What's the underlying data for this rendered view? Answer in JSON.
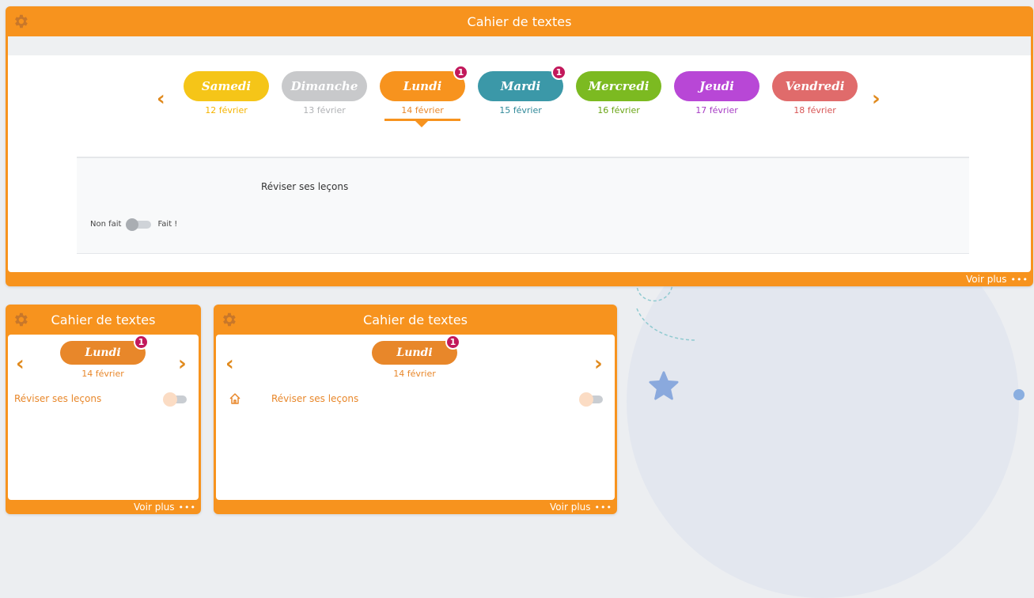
{
  "colors": {
    "accent": "#f7931e",
    "samedi": "#f5c518",
    "dimanche": "#c8c9cb",
    "lundi": "#f7931e",
    "mardi": "#3b98a8",
    "mercredi": "#7cba21",
    "jeudi": "#b847d6",
    "vendredi": "#e06b6b",
    "badge": "#c2185b"
  },
  "main_widget": {
    "title": "Cahier de textes",
    "days": [
      {
        "label": "Samedi",
        "date": "12 février",
        "color": "#f5c518",
        "date_color": "#f5b400",
        "badge": ""
      },
      {
        "label": "Dimanche",
        "date": "13 février",
        "color": "#c8c9cb",
        "date_color": "#b0b2b5",
        "badge": ""
      },
      {
        "label": "Lundi",
        "date": "14 février",
        "color": "#f7931e",
        "date_color": "#e8872a",
        "badge": "1"
      },
      {
        "label": "Mardi",
        "date": "15 février",
        "color": "#3b98a8",
        "date_color": "#2f8999",
        "badge": "1"
      },
      {
        "label": "Mercredi",
        "date": "16 février",
        "color": "#7cba21",
        "date_color": "#6aa515",
        "badge": ""
      },
      {
        "label": "Jeudi",
        "date": "17 février",
        "color": "#b847d6",
        "date_color": "#a63bc4",
        "badge": ""
      },
      {
        "label": "Vendredi",
        "date": "18 février",
        "color": "#e06b6b",
        "date_color": "#d85555",
        "badge": ""
      }
    ],
    "task": "Réviser ses leçons",
    "toggle_off_label": "Non fait",
    "toggle_on_label": "Fait !",
    "footer": "Voir plus",
    "footer_dots": "•••"
  },
  "widget_small": {
    "title": "Cahier de textes",
    "day_label": "Lundi",
    "day_date": "14 février",
    "badge": "1",
    "task": "Réviser ses leçons",
    "footer": "Voir plus",
    "footer_dots": "•••"
  },
  "widget_medium": {
    "title": "Cahier de textes",
    "day_label": "Lundi",
    "day_date": "14 février",
    "badge": "1",
    "task": "Réviser ses leçons",
    "footer": "Voir plus",
    "footer_dots": "•••"
  },
  "icons": {
    "settings": "gear-icon",
    "prev": "chevron-left-icon",
    "next": "chevron-right-icon",
    "home": "home-icon"
  }
}
